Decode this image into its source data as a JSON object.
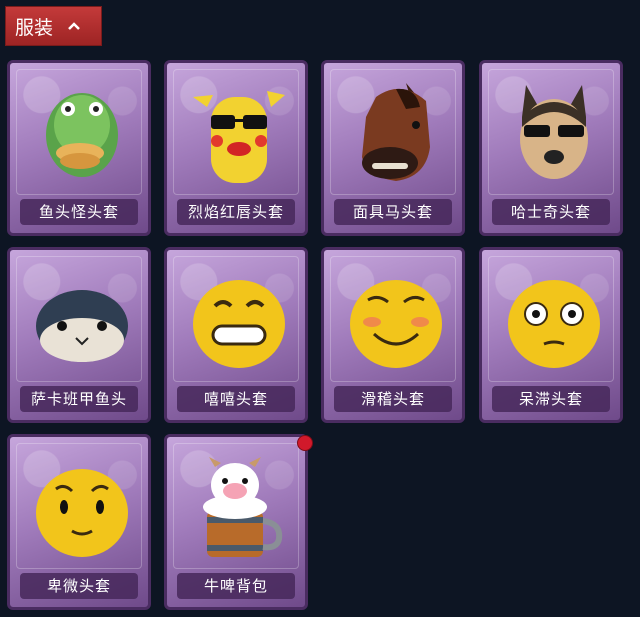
{
  "category": {
    "label": "服装",
    "icon": "chevron-up-icon"
  },
  "items": [
    {
      "name": "鱼头怪头套",
      "icon": "fish-head-mask-icon"
    },
    {
      "name": "烈焰红唇头套",
      "icon": "yellow-red-lips-mask-icon"
    },
    {
      "name": "面具马头套",
      "icon": "horse-mask-icon"
    },
    {
      "name": "哈士奇头套",
      "icon": "husky-mask-icon"
    },
    {
      "name": "萨卡班甲鱼头",
      "icon": "sacabambaspis-head-icon"
    },
    {
      "name": "嘻嘻头套",
      "icon": "grin-emoji-mask-icon"
    },
    {
      "name": "滑稽头套",
      "icon": "funny-emoji-mask-icon"
    },
    {
      "name": "呆滞头套",
      "icon": "stunned-emoji-mask-icon"
    },
    {
      "name": "卑微头套",
      "icon": "humble-emoji-mask-icon"
    },
    {
      "name": "牛啤背包",
      "icon": "cow-beer-backpack-icon",
      "new": true
    }
  ],
  "colors": {
    "card": "#a07bbb",
    "tab": "#b42f2f",
    "background": "#0d1523",
    "badge": "#d1192b"
  }
}
